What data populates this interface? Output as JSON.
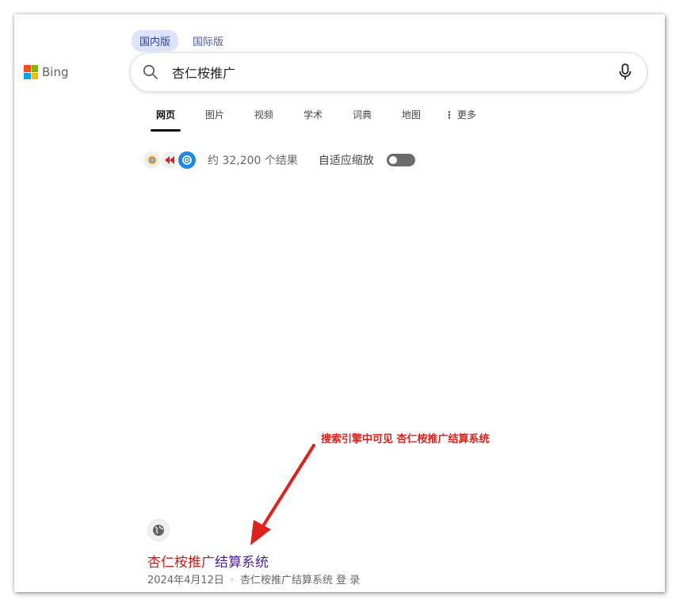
{
  "logo": {
    "text": "Bing",
    "colors": [
      "#f25022",
      "#7fba00",
      "#00a4ef",
      "#ffb900"
    ]
  },
  "region_tabs": [
    {
      "label": "国内版",
      "active": true
    },
    {
      "label": "国际版",
      "active": false
    }
  ],
  "search": {
    "value": "杏仁桉推广",
    "icon": "search-icon",
    "mic_icon": "microphone-icon"
  },
  "scopes": [
    {
      "label": "网页",
      "active": true
    },
    {
      "label": "图片"
    },
    {
      "label": "视频"
    },
    {
      "label": "学术"
    },
    {
      "label": "词典"
    },
    {
      "label": "地图"
    },
    {
      "label": "更多",
      "icon": "more-vertical-icon"
    }
  ],
  "infobar": {
    "count_text": "约 32,200 个结果",
    "adaptive_label": "自适应缩放",
    "toggle_on": false
  },
  "annotation": {
    "text": "搜索引擎中可见 杏仁桉推广结算系统",
    "color": "#e0201b"
  },
  "result": {
    "title_highlight": "杏仁桉推广",
    "title_rest": "结算系统",
    "date": "2024年4月12日",
    "snippet": "杏仁桉推广结算系统 登 录",
    "icon": "globe-icon"
  }
}
